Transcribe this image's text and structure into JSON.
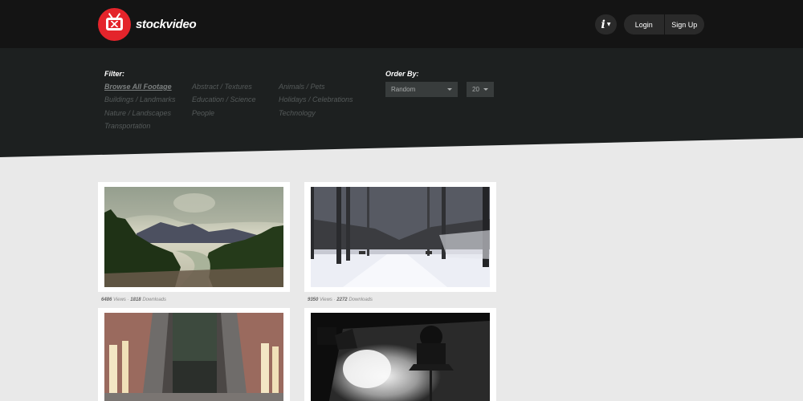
{
  "header": {
    "brand": "stockvideo",
    "info_label": "i",
    "login_label": "Login",
    "signup_label": "Sign Up"
  },
  "filter": {
    "label": "Filter:",
    "categories": [
      "Browse All Footage",
      "Buildings / Landmarks",
      "Nature / Landscapes",
      "Transportation",
      "Abstract / Textures",
      "Education / Science",
      "People",
      "Animals / Pets",
      "Holidays / Celebrations",
      "Technology"
    ],
    "active": "Browse All Footage"
  },
  "order": {
    "label": "Order By:",
    "sort_value": "Random",
    "count_value": "20"
  },
  "videos": [
    {
      "views": "6486",
      "views_label": "Views",
      "downloads": "1818",
      "downloads_label": "Downloads",
      "scene": "mountain-river"
    },
    {
      "views": "9350",
      "views_label": "Views",
      "downloads": "2272",
      "downloads_label": "Downloads",
      "scene": "snowy-park"
    },
    {
      "views": "",
      "downloads": "",
      "scene": "escalators"
    },
    {
      "views": "",
      "downloads": "",
      "scene": "studio-light"
    }
  ],
  "colors": {
    "header_bg": "#141414",
    "filter_bg": "#1d2020",
    "page_bg": "#e9e9e9",
    "brand_red": "#e4242b"
  }
}
